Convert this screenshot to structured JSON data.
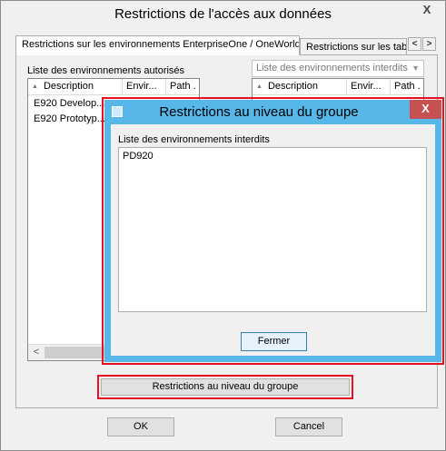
{
  "window": {
    "title": "Restrictions de l'accès aux données",
    "close_glyph": "X"
  },
  "tabs": [
    {
      "label": "Restrictions sur les environnements EnterpriseOne / OneWorld",
      "active": true
    },
    {
      "label": "Restrictions sur les tables",
      "active": false
    }
  ],
  "tab_scroll": {
    "left": "<",
    "right": ">"
  },
  "allowed": {
    "label": "Liste des environnements autorisés",
    "columns": [
      "Description",
      "Envir...",
      "Path ."
    ],
    "rows": [
      "E920 Develop...",
      "E920 Prototyp..."
    ],
    "scroll_left": "<"
  },
  "forbidden": {
    "dropdown_value": "Liste des environnements interdits",
    "columns": [
      "Description",
      "Envir...",
      "Path ."
    ]
  },
  "group_button": {
    "label": "Restrictions au niveau du groupe"
  },
  "ok_button": {
    "label": "OK"
  },
  "cancel_button": {
    "label": "Cancel"
  },
  "dialog": {
    "title": "Restrictions au niveau du groupe",
    "close_glyph": "X",
    "list_label": "Liste des environnements interdits",
    "items": [
      "PD920"
    ],
    "close_button": "Fermer"
  },
  "colors": {
    "highlight": "#e81123",
    "dialog_frame": "#56b7e8",
    "dialog_close": "#c75050"
  }
}
